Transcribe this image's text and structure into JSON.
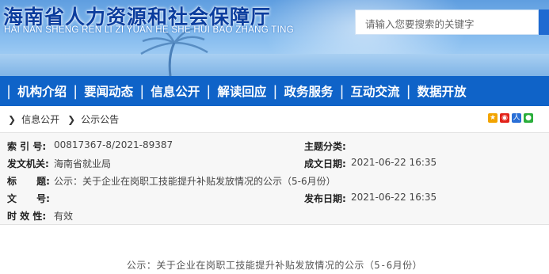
{
  "header": {
    "title": "海南省人力资源和社会保障厅",
    "subtitle": "HAI NAN SHENG REN LI ZI YUAN HE SHE HUI BAO ZHANG TING",
    "search_placeholder": "请输入您要搜索的关键字"
  },
  "nav": {
    "items": [
      "机构介绍",
      "要闻动态",
      "信息公开",
      "解读回应",
      "政务服务",
      "互动交流",
      "数据开放"
    ]
  },
  "breadcrumb": {
    "items": [
      "信息公开",
      "公示公告"
    ]
  },
  "share_icons": [
    "qzone-icon",
    "weibo-icon",
    "renren-icon",
    "wechat-icon"
  ],
  "info": {
    "index_label": "索 引 号:",
    "index_value": "00817367-8/2021-89387",
    "topic_label": "主题分类:",
    "topic_value": "",
    "issuer_label": "发文机关:",
    "issuer_value": "海南省就业局",
    "created_label": "成文日期:",
    "created_value": "2021-06-22 16:35",
    "title_label": "标      题:",
    "title_value": "公示：关于企业在岗职工技能提升补贴发放情况的公示（5-6月份）",
    "docno_label": "文      号:",
    "docno_value": "",
    "published_label": "发布日期:",
    "published_value": "2021-06-22 16:35",
    "validity_label": "时 效 性:",
    "validity_value": "有效"
  },
  "article": {
    "title": "公示：关于企业在岗职工技能提升补贴发放情况的公示（5-6月份）"
  }
}
